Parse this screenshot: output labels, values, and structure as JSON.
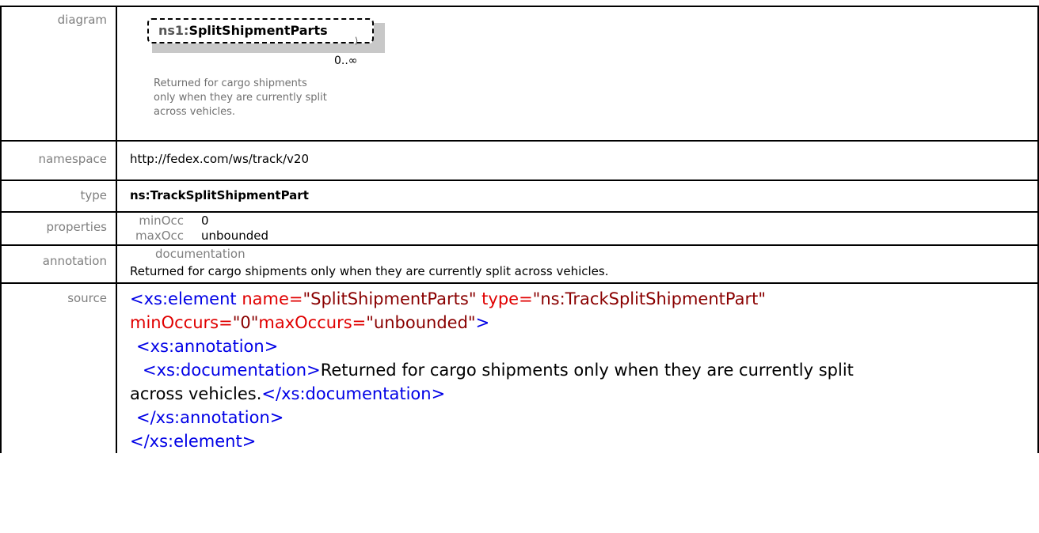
{
  "labels": {
    "diagram": "diagram",
    "namespace": "namespace",
    "type": "type",
    "properties": "properties",
    "annotation": "annotation",
    "source": "source"
  },
  "diagram": {
    "prefix": "ns1:",
    "name": "SplitShipmentParts",
    "occurrence": "0..∞",
    "doc_lines": [
      "Returned for cargo shipments",
      "only when they are currently split",
      "across vehicles."
    ]
  },
  "namespace": "http://fedex.com/ws/track/v20",
  "type": "ns:TrackSplitShipmentPart",
  "properties": {
    "minOcc_label": "minOcc",
    "minOcc_value": "0",
    "maxOcc_label": "maxOcc",
    "maxOcc_value": "unbounded"
  },
  "annotation": {
    "label": "documentation",
    "text": "Returned for cargo shipments only when they are currently split across vehicles."
  },
  "source": {
    "open_tag": "<xs:element",
    "attr_name": " name=",
    "attr_name_val": "\"SplitShipmentParts\"",
    "attr_type": " type=",
    "attr_type_val": "\"ns:TrackSplitShipmentPart\"",
    "attr_min": "minOccurs=",
    "attr_min_val": "\"0\"",
    "attr_max": "maxOccurs=",
    "attr_max_val": "\"unbounded\"",
    "gt": ">",
    "ann_open": "<xs:annotation>",
    "doc_open_tag": "<xs:documentation",
    "doc_open_gt": ">",
    "doc_text_1": "Returned for cargo shipments only when they are currently split",
    "doc_text_2": "across vehicles.",
    "doc_close": "</xs:documentation>",
    "ann_close": "</xs:annotation>",
    "el_close": "</xs:element>"
  },
  "colors": {
    "tag": "#0000e6",
    "attribute_name": "#e00000",
    "attribute_value": "#8a0000",
    "label": "#7f7f7f"
  }
}
